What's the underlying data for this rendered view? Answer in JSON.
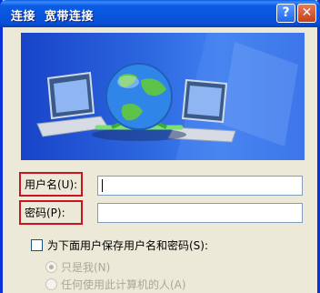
{
  "window": {
    "title": "连接  宽带连接",
    "help_glyph": "?",
    "close_glyph": "✕"
  },
  "form": {
    "username_label": "用户名(U):",
    "username_value": "",
    "password_label": "密码(P):",
    "password_value": ""
  },
  "save": {
    "checkbox_label": "为下面用户保存用户名和密码(S):",
    "checked": false,
    "options": [
      {
        "label": "只是我(N)",
        "selected": true,
        "enabled": false
      },
      {
        "label": "任何使用此计算机的人(A)",
        "selected": false,
        "enabled": false
      }
    ]
  },
  "colors": {
    "title_bar": "#0a5fe8",
    "highlight_box": "#c8141e",
    "dialog_bg": "#ece9d8"
  }
}
